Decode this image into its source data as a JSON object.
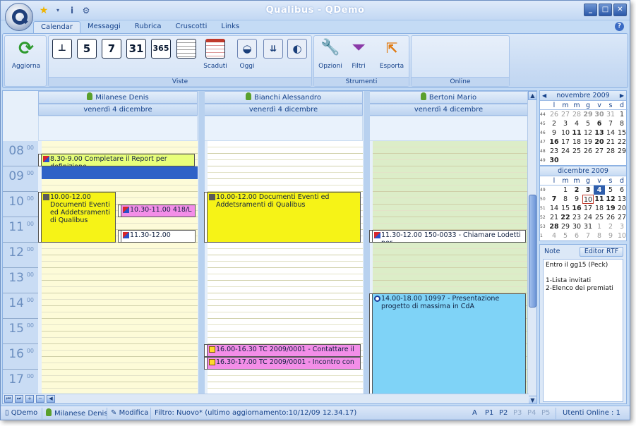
{
  "window": {
    "title": "Qualibus  -  QDemo"
  },
  "tabs": [
    "Calendar",
    "Messaggi",
    "Rubrica",
    "Cruscotti",
    "Links"
  ],
  "ribbon": {
    "aggiorna": "Aggiorna",
    "views": [
      "5",
      "7",
      "31",
      "365"
    ],
    "scaduti": "Scaduti",
    "oggi": "Oggi",
    "opzioni": "Opzioni",
    "filtri": "Filtri",
    "esporta": "Esporta",
    "groups": {
      "viste": "Viste",
      "strumenti": "Strumenti",
      "online": "Online"
    }
  },
  "columns": [
    {
      "name": "Milanese Denis",
      "date": "venerdì 4 dicembre"
    },
    {
      "name": "Bianchi Alessandro",
      "date": "venerdì 4 dicembre"
    },
    {
      "name": "Bertoni Mario",
      "date": "venerdì 4 dicembre"
    }
  ],
  "hours": [
    "08",
    "09",
    "10",
    "11",
    "12",
    "13",
    "14",
    "15",
    "16",
    "17"
  ],
  "minutes": "00",
  "appointments": {
    "a1": "8.30-9.00 Completare il Report per definizione",
    "a2": "10.00-12.00 Documenti Eventi ed Addetsramenti di Qualibus",
    "a3": "10.30-11.00 418/L -",
    "a4": "11.30-12.00",
    "a5": "10.00-12.00 Documenti Eventi ed Addetsramenti di Qualibus",
    "a6": "16.00-16.30 TC 2009/0001 - Contattare il",
    "a7": "16.30-17.00 TC 2009/0001 - Incontro con",
    "a8": "11.30-12.00 150-0033 - Chiamare Lodetti per",
    "a9": "14.00-18.00 10997 - Presentazione progetto di massima in CdA"
  },
  "minical_nov": {
    "title": "novembre 2009",
    "dow": [
      "l",
      "m",
      "m",
      "g",
      "v",
      "s",
      "d"
    ],
    "weeks": [
      {
        "wk": "44",
        "days": [
          "26",
          "27",
          "28",
          "29",
          "30",
          "31",
          "1"
        ]
      },
      {
        "wk": "45",
        "days": [
          "2",
          "3",
          "4",
          "5",
          "6",
          "7",
          "8"
        ]
      },
      {
        "wk": "46",
        "days": [
          "9",
          "10",
          "11",
          "12",
          "13",
          "14",
          "15"
        ]
      },
      {
        "wk": "47",
        "days": [
          "16",
          "17",
          "18",
          "19",
          "20",
          "21",
          "22"
        ]
      },
      {
        "wk": "48",
        "days": [
          "23",
          "24",
          "25",
          "26",
          "27",
          "28",
          "29"
        ]
      },
      {
        "wk": "49",
        "days": [
          "30",
          "",
          "",
          "",
          "",
          "",
          ""
        ]
      }
    ]
  },
  "minical_dec": {
    "title": "dicembre 2009",
    "dow": [
      "l",
      "m",
      "m",
      "g",
      "v",
      "s",
      "d"
    ],
    "weeks": [
      {
        "wk": "49",
        "days": [
          "",
          "1",
          "2",
          "3",
          "4",
          "5",
          "6"
        ]
      },
      {
        "wk": "50",
        "days": [
          "7",
          "8",
          "9",
          "10",
          "11",
          "12",
          "13"
        ]
      },
      {
        "wk": "51",
        "days": [
          "14",
          "15",
          "16",
          "17",
          "18",
          "19",
          "20"
        ]
      },
      {
        "wk": "52",
        "days": [
          "21",
          "22",
          "23",
          "24",
          "25",
          "26",
          "27"
        ]
      },
      {
        "wk": "53",
        "days": [
          "28",
          "29",
          "30",
          "31",
          "1",
          "2",
          "3"
        ]
      },
      {
        "wk": "1",
        "days": [
          "4",
          "5",
          "6",
          "7",
          "8",
          "9",
          "10"
        ]
      }
    ]
  },
  "notes": {
    "label": "Note",
    "button": "Editor RTF",
    "lines": [
      "Entro il gg15 (Peck)",
      "",
      "1-Lista invitati",
      "2-Elenco dei premiati"
    ]
  },
  "status": {
    "db": "QDemo",
    "user": "Milanese Denis",
    "modifica": "Modifica",
    "filtro": "Filtro: Nuovo* (ultimo aggiornamento:10/12/09 12.34.17)",
    "pages": [
      "A",
      "P1",
      "P2",
      "P3",
      "P4",
      "P5"
    ],
    "online": "Utenti Online : 1"
  }
}
